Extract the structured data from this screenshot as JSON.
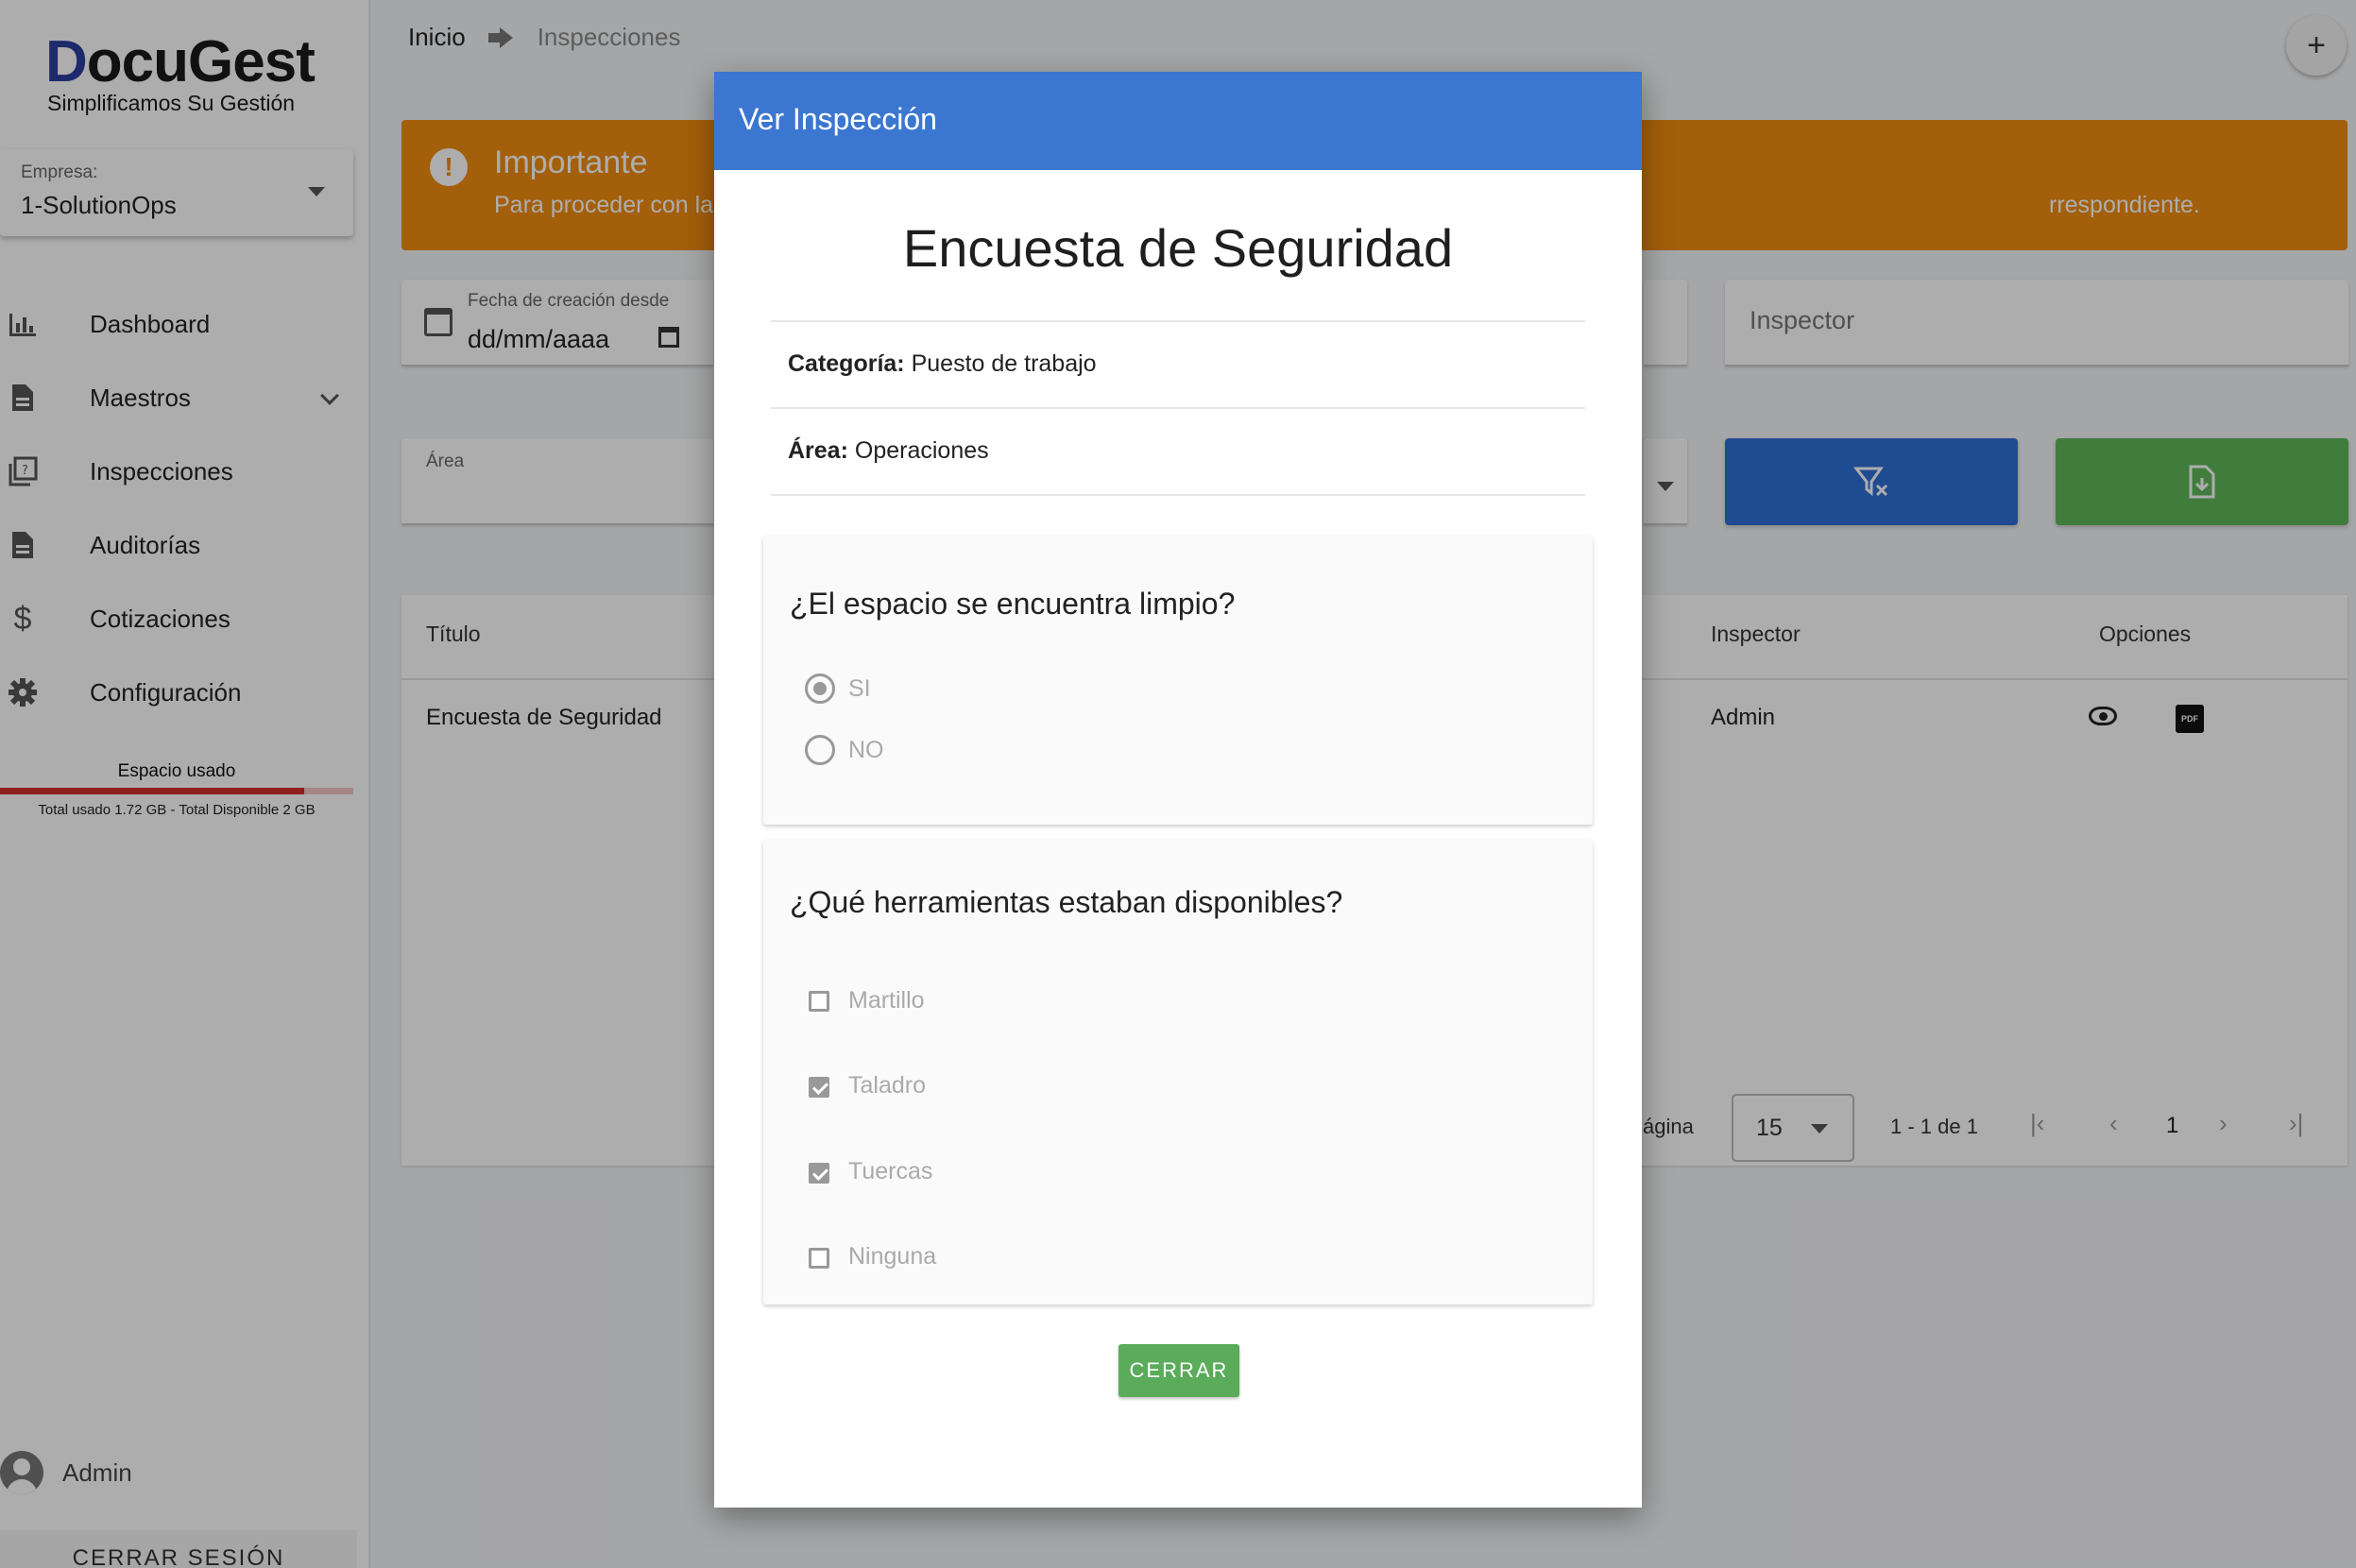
{
  "app": {
    "logo_main": "ocuGest",
    "logo_initial": "D",
    "logo_tagline": "Simplificamos Su Gestión"
  },
  "company_selector": {
    "label": "Empresa:",
    "value": "1-SolutionOps"
  },
  "sidebar": {
    "items": [
      {
        "label": "Dashboard",
        "icon": "bar-chart-icon"
      },
      {
        "label": "Maestros",
        "icon": "document-icon"
      },
      {
        "label": "Inspecciones",
        "icon": "clipboard-icon"
      },
      {
        "label": "Auditorías",
        "icon": "document-icon"
      },
      {
        "label": "Cotizaciones",
        "icon": "dollar-icon"
      },
      {
        "label": "Configuración",
        "icon": "gear-icon"
      }
    ],
    "storage": {
      "title": "Espacio usado",
      "detail": "Total usado 1.72 GB - Total Disponible 2 GB",
      "used_fraction": 0.86
    },
    "user_name": "Admin",
    "logout_label": "CERRAR SESIÓN"
  },
  "breadcrumb": {
    "home": "Inicio",
    "current": "Inspecciones"
  },
  "fab_label": "+",
  "alert": {
    "title": "Importante",
    "text_start": "Para proceder con la",
    "text_end": "rrespondiente.",
    "color": "#f08c0f"
  },
  "filters": {
    "date_from_label": "Fecha de creación desde",
    "date_from_value": "dd/mm/aaaa",
    "inspector_placeholder": "Inspector",
    "area_label": "Área"
  },
  "table": {
    "headers": {
      "title": "Título",
      "inspector": "Inspector",
      "options": "Opciones"
    },
    "rows": [
      {
        "title": "Encuesta de Seguridad",
        "inspector": "Admin"
      }
    ],
    "pagination": {
      "per_page_label": "ágina",
      "per_page": "15",
      "range": "1 - 1 de 1",
      "page": "1"
    }
  },
  "modal": {
    "header": "Ver Inspección",
    "title": "Encuesta de Seguridad",
    "category_label": "Categoría:",
    "category_value": "Puesto de trabajo",
    "area_label": "Área:",
    "area_value": "Operaciones",
    "q1": {
      "text": "¿El espacio se encuentra limpio?",
      "options": [
        {
          "label": "SI",
          "selected": true
        },
        {
          "label": "NO",
          "selected": false
        }
      ]
    },
    "q2": {
      "text": "¿Qué herramientas estaban disponibles?",
      "options": [
        {
          "label": "Martillo",
          "checked": false
        },
        {
          "label": "Taladro",
          "checked": true
        },
        {
          "label": "Tuercas",
          "checked": true
        },
        {
          "label": "Ninguna",
          "checked": false
        }
      ]
    },
    "close_label": "CERRAR"
  }
}
